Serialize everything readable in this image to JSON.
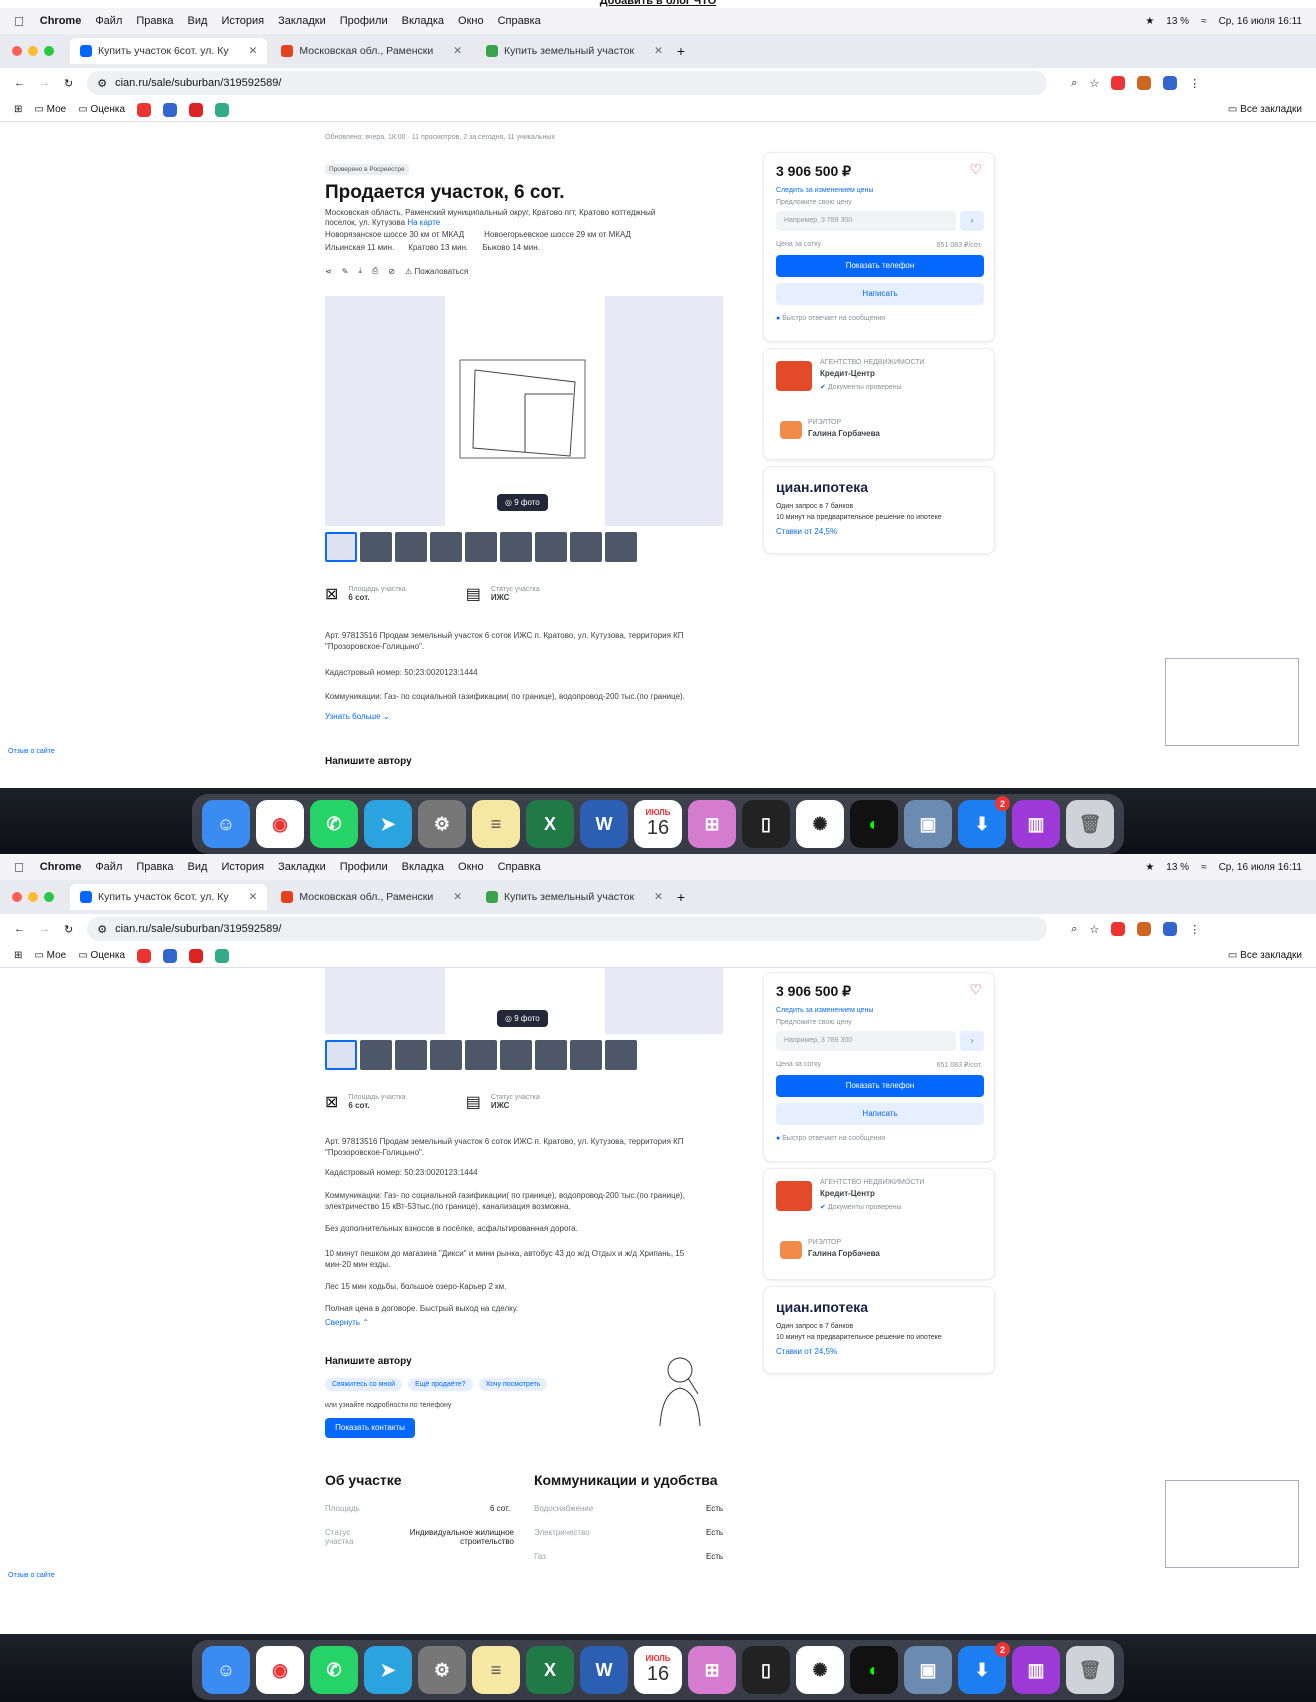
{
  "caption": "Добавить в блог ЧТО",
  "menubar": {
    "app": "Chrome",
    "items": [
      "Файл",
      "Правка",
      "Вид",
      "История",
      "Закладки",
      "Профили",
      "Вкладка",
      "Окно",
      "Справка"
    ],
    "battery": "13 %",
    "datetime": "Ср, 16 июля 16:11"
  },
  "tabs": [
    {
      "label": "Купить участок 6сот. ул. Ку",
      "fav_color": "#0468ff",
      "active": true
    },
    {
      "label": "Московская обл., Раменски",
      "fav_color": "#e2431e",
      "active": false
    },
    {
      "label": "Купить земельный участок",
      "fav_color": "#3aa34a",
      "active": false
    }
  ],
  "address": {
    "url": "cian.ru/sale/suburban/319592589/"
  },
  "bookmarks": {
    "items": [
      "Мое",
      "Оценка"
    ],
    "all": "Все закладки"
  },
  "listing": {
    "meta": "Обновлено: вчера, 18:00 · 11 просмотров, 2 за сегодня, 11 уникальных",
    "badge": "Проверено в Росреестре",
    "title": "Продается участок, 6 сот.",
    "address": "Московская область, Раменский муниципальный округ, Кратово пгт, Кратово коттеджный поселок, ул. Кутузова",
    "map_link": "На карте",
    "highways": [
      "Новорязанское шоссе 30 км от МКАД",
      "Новоегорьевское шоссе 29 км от МКАД"
    ],
    "stations": [
      "Ильинская 11 мин.",
      "Кратово 13 мин.",
      "Быково 14 мин."
    ],
    "complain": "Пожаловаться",
    "photo_btn": "9 фото",
    "area_label": "Площадь участка",
    "area_value": "6 сот.",
    "status_label": "Статус участка",
    "status_value": "ИЖС",
    "desc1": "Арт. 97813516 Продам земельный участок 6 соток ИЖС п. Кратово, ул. Кутузова, территория КП \"Прозоровское-Голицыно\".",
    "cadastral": "Кадастровый номер: 50:23:0020123:1444",
    "comms_short": "Коммуникации: Газ- по социальной газификации( по границе), водопровод-200 тыс.(по границе).",
    "comms_full": "Коммуникации: Газ- по социальной газификации( по границе), водопровод-200 тыс.(по границе), электричество 15 кВт-53тыс.(по границе), канализация возможна.",
    "extra": "Без дополнительных взносов в посёлке, асфальтированная дорога.",
    "walk": "10 минут пешком до магазина \"Дикси\" и мини рынка, автобус 43 до ж/д Отдых и ж/д Хрипань, 15 мин-20 мин езды.",
    "forest": "Лес 15 мин ходьбы, большое озеро-Карьер 2 км.",
    "deal": "Полная цена в договоре. Быстрый выход на сделку.",
    "more": "Узнать больше",
    "less": "Свернуть",
    "write_author": "Напишите автору",
    "chips": [
      "Свяжитесь со мной",
      "Ещё продаёте?",
      "Хочу посмотреть"
    ],
    "or_phone": "или узнайте подробности по телефону",
    "show_contacts": "Показать контакты",
    "about": "Об участке",
    "comms_title": "Коммуникации и удобства",
    "about_rows": [
      {
        "label": "Площадь",
        "value": "6 сот."
      },
      {
        "label": "Статус участка",
        "value": "Индивидуальное жилищное строительство"
      }
    ],
    "comms_rows": [
      {
        "label": "Водоснабжение",
        "value": "Есть"
      },
      {
        "label": "Электричество",
        "value": "Есть"
      },
      {
        "label": "Газ",
        "value": "Есть"
      }
    ]
  },
  "sidebar": {
    "price": "3 906 500 ₽",
    "follow": "Следить за изменением цены",
    "offer_label": "Предложите свою цену",
    "offer_placeholder": "Например, 3 789 300",
    "per_sotka_label": "Цена за сотку",
    "per_sotka_value": "651 083 ₽/сот.",
    "show_phone": "Показать телефон",
    "write": "Написать",
    "fast_reply": "Быстро отвечает на сообщения",
    "agency_type": "АГЕНТСТВО НЕДВИЖИМОСТИ",
    "agency_name": "Кредит-Центр",
    "docs_checked": "Документы проверены",
    "realtor_label": "РИЭЛТОР",
    "realtor_name": "Галина Горбачева",
    "mortgage_brand": "циан.ипотека",
    "mortgage_l1": "Один запрос в 7 банков",
    "mortgage_l2": "10 минут на предварительное решение по ипотеке",
    "mortgage_rate": "Ставки от 24,5%"
  },
  "feedback": "Отзыв о сайте",
  "dock": {
    "calendar_month": "ИЮЛЬ",
    "calendar_day": "16",
    "badge_count": "2"
  }
}
